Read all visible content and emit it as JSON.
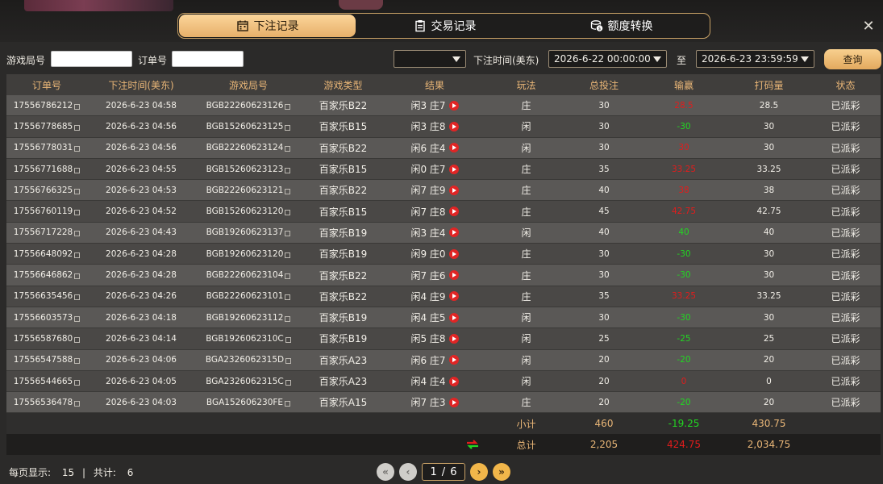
{
  "tabs": [
    {
      "label": "下注记录",
      "icon": "calendar-icon",
      "active": true
    },
    {
      "label": "交易记录",
      "icon": "clipboard-icon",
      "active": false
    },
    {
      "label": "额度转换",
      "icon": "coins-icon",
      "active": false
    }
  ],
  "filters": {
    "game_no_label": "游戏局号",
    "game_no_value": "",
    "order_no_label": "订单号",
    "order_no_value": "",
    "game_select_value": "",
    "time_label": "下注时间(美东)",
    "start_time": "2026-6-22 00:00:00",
    "to_label": "至",
    "end_time": "2026-6-23 23:59:59",
    "query_label": "查询"
  },
  "table": {
    "headers": [
      "订单号",
      "下注时间(美东)",
      "游戏局号",
      "游戏类型",
      "结果",
      "玩法",
      "总投注",
      "输赢",
      "打码量",
      "状态"
    ],
    "rows": [
      {
        "order": "17556786212",
        "time": "2026-6-23 04:58",
        "round": "BGB22260623126",
        "game": "百家乐B22",
        "result": "闲3 庄7",
        "play": "庄",
        "bet": "30",
        "winloss": "28.5",
        "wl": "lose",
        "turnover": "28.5",
        "status": "已派彩"
      },
      {
        "order": "17556778685",
        "time": "2026-6-23 04:56",
        "round": "BGB15260623125",
        "game": "百家乐B15",
        "result": "闲3 庄8",
        "play": "闲",
        "bet": "30",
        "winloss": "-30",
        "wl": "win",
        "turnover": "30",
        "status": "已派彩"
      },
      {
        "order": "17556778031",
        "time": "2026-6-23 04:56",
        "round": "BGB22260623124",
        "game": "百家乐B22",
        "result": "闲6 庄4",
        "play": "闲",
        "bet": "30",
        "winloss": "30",
        "wl": "lose",
        "turnover": "30",
        "status": "已派彩"
      },
      {
        "order": "17556771688",
        "time": "2026-6-23 04:55",
        "round": "BGB15260623123",
        "game": "百家乐B15",
        "result": "闲0 庄7",
        "play": "庄",
        "bet": "35",
        "winloss": "33.25",
        "wl": "lose",
        "turnover": "33.25",
        "status": "已派彩"
      },
      {
        "order": "17556766325",
        "time": "2026-6-23 04:53",
        "round": "BGB22260623121",
        "game": "百家乐B22",
        "result": "闲7 庄9",
        "play": "庄",
        "bet": "40",
        "winloss": "38",
        "wl": "lose",
        "turnover": "38",
        "status": "已派彩"
      },
      {
        "order": "17556760119",
        "time": "2026-6-23 04:52",
        "round": "BGB15260623120",
        "game": "百家乐B15",
        "result": "闲7 庄8",
        "play": "庄",
        "bet": "45",
        "winloss": "42.75",
        "wl": "lose",
        "turnover": "42.75",
        "status": "已派彩"
      },
      {
        "order": "17556717228",
        "time": "2026-6-23 04:43",
        "round": "BGB19260623137",
        "game": "百家乐B19",
        "result": "闲3 庄4",
        "play": "闲",
        "bet": "40",
        "winloss": "40",
        "wl": "win",
        "turnover": "40",
        "status": "已派彩"
      },
      {
        "order": "17556648092",
        "time": "2026-6-23 04:28",
        "round": "BGB19260623120",
        "game": "百家乐B19",
        "result": "闲9 庄0",
        "play": "庄",
        "bet": "30",
        "winloss": "-30",
        "wl": "win",
        "turnover": "30",
        "status": "已派彩"
      },
      {
        "order": "17556646862",
        "time": "2026-6-23 04:28",
        "round": "BGB22260623104",
        "game": "百家乐B22",
        "result": "闲7 庄6",
        "play": "庄",
        "bet": "30",
        "winloss": "-30",
        "wl": "win",
        "turnover": "30",
        "status": "已派彩"
      },
      {
        "order": "17556635456",
        "time": "2026-6-23 04:26",
        "round": "BGB22260623101",
        "game": "百家乐B22",
        "result": "闲4 庄9",
        "play": "庄",
        "bet": "35",
        "winloss": "33.25",
        "wl": "lose",
        "turnover": "33.25",
        "status": "已派彩"
      },
      {
        "order": "17556603573",
        "time": "2026-6-23 04:18",
        "round": "BGB19260623112",
        "game": "百家乐B19",
        "result": "闲4 庄5",
        "play": "闲",
        "bet": "30",
        "winloss": "-30",
        "wl": "win",
        "turnover": "30",
        "status": "已派彩"
      },
      {
        "order": "17556587680",
        "time": "2026-6-23 04:14",
        "round": "BGB1926062310C",
        "game": "百家乐B19",
        "result": "闲5 庄8",
        "play": "闲",
        "bet": "25",
        "winloss": "-25",
        "wl": "win",
        "turnover": "25",
        "status": "已派彩"
      },
      {
        "order": "17556547588",
        "time": "2026-6-23 04:06",
        "round": "BGA2326062315D",
        "game": "百家乐A23",
        "result": "闲6 庄7",
        "play": "闲",
        "bet": "20",
        "winloss": "-20",
        "wl": "win",
        "turnover": "20",
        "status": "已派彩"
      },
      {
        "order": "17556544665",
        "time": "2026-6-23 04:05",
        "round": "BGA2326062315C",
        "game": "百家乐A23",
        "result": "闲4 庄4",
        "play": "闲",
        "bet": "20",
        "winloss": "0",
        "wl": "lose",
        "turnover": "0",
        "status": "已派彩"
      },
      {
        "order": "17556536478",
        "time": "2026-6-23 04:03",
        "round": "BGA152606230FE",
        "game": "百家乐A15",
        "result": "闲7 庄3",
        "play": "庄",
        "bet": "20",
        "winloss": "-20",
        "wl": "win",
        "turnover": "20",
        "status": "已派彩"
      }
    ],
    "subtotal": {
      "label": "小计",
      "bet": "460",
      "winloss": "-19.25",
      "turnover": "430.75"
    },
    "total": {
      "label": "总计",
      "bet": "2,205",
      "winloss": "424.75",
      "turnover": "2,034.75"
    }
  },
  "pagination": {
    "per_page_label": "每页显示:",
    "per_page": "15",
    "separator": "|",
    "total_label": "共计:",
    "total_pages": "6",
    "current": "1",
    "slash": "/",
    "last": "6"
  },
  "colors": {
    "accent_gold": "#e9b677",
    "win_green": "#22d622",
    "lose_red": "#e21c1c"
  }
}
